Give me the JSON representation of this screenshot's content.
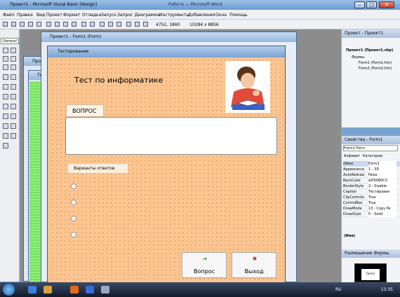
{
  "app": {
    "title": "Проект1 - Microsoft Visual Basic [design]",
    "center_title": "Работа — Microsoft Word",
    "minimize": "–",
    "maximize": "□",
    "close": "✕"
  },
  "menu": [
    "Файл",
    "Правка",
    "Вид",
    "Проект",
    "Формат",
    "Отладка",
    "Запуск",
    "Запрос",
    "Диаграмма",
    "Инструменты",
    "Добавления",
    "Окна",
    "Помощь"
  ],
  "toolbar": {
    "position": "4752, 1860",
    "size": "10284 x 8856"
  },
  "toolbox": {
    "header": "General"
  },
  "mdi": {
    "bg_window1_title": "Проект",
    "bg_window2_title": "Тест",
    "project_window_title": "Проект1 - Form1 (Form)"
  },
  "form": {
    "caption": "Тестирование",
    "heading": "Тест по информатике",
    "question_tab": "ВОПРОС",
    "answers_label": "Варианты ответов",
    "button_question": "Вопрос",
    "button_exit": "Выход",
    "bg_color": "#fcc590"
  },
  "project_panel": {
    "title": "Проект - Проект1",
    "tree": [
      "Проект1 (Проект1.vbp)",
      "Формы",
      "Form1 (Form1.frm)",
      "Form2 (Form2.frm)"
    ]
  },
  "properties_panel": {
    "title": "Свойства - Form1",
    "object": "Form1  Form",
    "tabs": [
      "Алфавит",
      "Категории"
    ],
    "rows": [
      {
        "name": "(Имя)",
        "value": "Form1"
      },
      {
        "name": "Appearance",
        "value": "1 - 3D"
      },
      {
        "name": "AutoRedraw",
        "value": "False"
      },
      {
        "name": "BackColor",
        "value": "&H0080C0"
      },
      {
        "name": "BorderStyle",
        "value": "2 - Sizable"
      },
      {
        "name": "Caption",
        "value": "Тестирован"
      },
      {
        "name": "ClipControls",
        "value": "True"
      },
      {
        "name": "ControlBox",
        "value": "True"
      },
      {
        "name": "DrawMode",
        "value": "13 - Copy Pe"
      },
      {
        "name": "DrawStyle",
        "value": "0 - Solid"
      }
    ],
    "description": "(Имя)"
  },
  "layout_panel": {
    "title": "Размещение Формы",
    "preview_label": "Form1"
  },
  "taskbar": {
    "lang": "RU",
    "time": "13:35"
  }
}
